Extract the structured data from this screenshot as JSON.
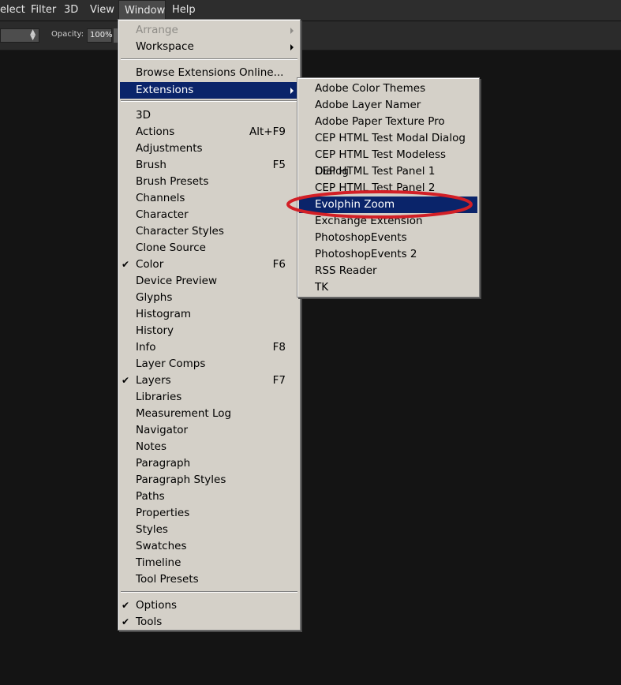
{
  "menubar": {
    "items": [
      {
        "label": "elect"
      },
      {
        "label": "Filter"
      },
      {
        "label": "3D"
      },
      {
        "label": "View"
      },
      {
        "label": "Window"
      },
      {
        "label": "Help"
      }
    ]
  },
  "options_bar": {
    "opacity_label": "Opacity:",
    "opacity_value": "100%"
  },
  "window_menu": {
    "items": [
      {
        "label": "Arrange",
        "disabled": true,
        "submenu": true
      },
      {
        "label": "Workspace",
        "submenu": true
      },
      {
        "label": "Browse Extensions Online..."
      },
      {
        "label": "Extensions",
        "submenu": true,
        "highlighted": true
      },
      {
        "label": "3D"
      },
      {
        "label": "Actions",
        "shortcut": "Alt+F9"
      },
      {
        "label": "Adjustments"
      },
      {
        "label": "Brush",
        "shortcut": "F5"
      },
      {
        "label": "Brush Presets"
      },
      {
        "label": "Channels"
      },
      {
        "label": "Character"
      },
      {
        "label": "Character Styles"
      },
      {
        "label": "Clone Source"
      },
      {
        "label": "Color",
        "shortcut": "F6",
        "checked": true
      },
      {
        "label": "Device Preview"
      },
      {
        "label": "Glyphs"
      },
      {
        "label": "Histogram"
      },
      {
        "label": "History"
      },
      {
        "label": "Info",
        "shortcut": "F8"
      },
      {
        "label": "Layer Comps"
      },
      {
        "label": "Layers",
        "shortcut": "F7",
        "checked": true
      },
      {
        "label": "Libraries"
      },
      {
        "label": "Measurement Log"
      },
      {
        "label": "Navigator"
      },
      {
        "label": "Notes"
      },
      {
        "label": "Paragraph"
      },
      {
        "label": "Paragraph Styles"
      },
      {
        "label": "Paths"
      },
      {
        "label": "Properties"
      },
      {
        "label": "Styles"
      },
      {
        "label": "Swatches"
      },
      {
        "label": "Timeline"
      },
      {
        "label": "Tool Presets"
      },
      {
        "label": "Options",
        "checked": true
      },
      {
        "label": "Tools",
        "checked": true
      }
    ],
    "check_glyph": "✔"
  },
  "extensions_menu": {
    "items": [
      {
        "label": "Adobe Color Themes"
      },
      {
        "label": "Adobe Layer Namer"
      },
      {
        "label": "Adobe Paper Texture Pro"
      },
      {
        "label": "CEP HTML Test Modal Dialog"
      },
      {
        "label": "CEP HTML Test Modeless Dialog"
      },
      {
        "label": "CEP HTML Test Panel 1"
      },
      {
        "label": "CEP HTML Test Panel 2"
      },
      {
        "label": "Evolphin Zoom",
        "highlighted": true
      },
      {
        "label": "Exchange Extension"
      },
      {
        "label": "PhotoshopEvents"
      },
      {
        "label": "PhotoshopEvents 2"
      },
      {
        "label": "RSS Reader"
      },
      {
        "label": "TK"
      }
    ]
  },
  "colors": {
    "highlight": "#0a246a",
    "annotation": "#d21f26",
    "menu_bg": "#d4d0c8"
  }
}
